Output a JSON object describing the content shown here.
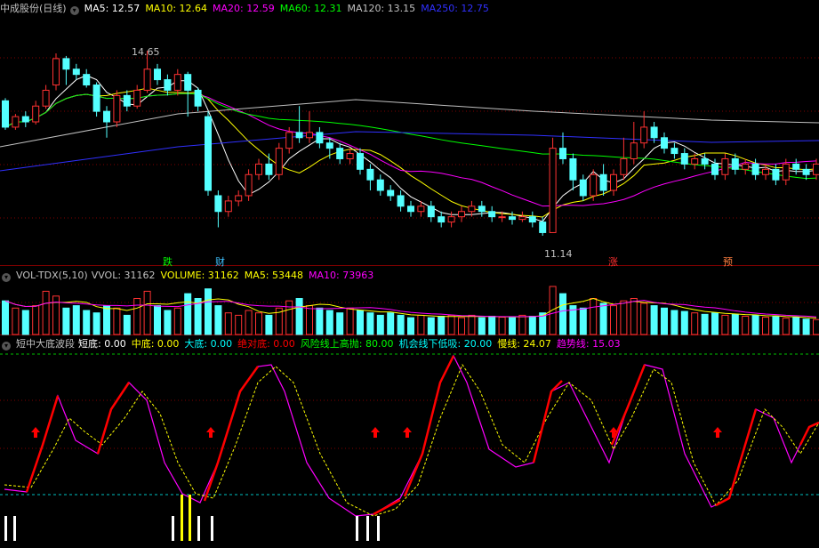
{
  "colors": {
    "up": "#ff3232",
    "down": "#54ffff",
    "ma5": "#ffffff",
    "ma10": "#ffff00",
    "ma20": "#ff00ff",
    "ma60": "#00ff00",
    "ma120": "#c0c0c0",
    "ma250": "#3030ff",
    "grid": "#800000",
    "text": "#c0c0c0"
  },
  "price_panel": {
    "header": {
      "title": "中成股份(日线)",
      "ma5": "MA5: 12.57",
      "ma10": "MA10: 12.64",
      "ma20": "MA20: 12.59",
      "ma60": "MA60: 12.31",
      "ma120": "MA120: 13.15",
      "ma250": "MA250: 12.75"
    },
    "high_label": "14.65",
    "low_label": "11.14",
    "markers": [
      {
        "text": "跌",
        "color": "#00ff00"
      },
      {
        "text": "财",
        "color": "#3ec1ff"
      },
      {
        "text": "涨",
        "color": "#ff3030"
      },
      {
        "text": "预",
        "color": "#ff8040"
      }
    ]
  },
  "volume_panel": {
    "header": {
      "title": "VOL-TDX(5,10)",
      "vvol": "VVOL: 31162",
      "volume": "VOLUME: 31162",
      "ma5": "MA5: 53448",
      "ma10": "MA10: 73963"
    }
  },
  "indicator_panel": {
    "header": {
      "title": "短中大底波段",
      "short": "短底: 0.00",
      "mid": "中底: 0.00",
      "big": "大底: 0.00",
      "abs": "绝对底: 0.00",
      "risk": "风险线上高抛: 80.00",
      "chance": "机会线下低吸: 20.00",
      "slow": "慢线: 24.07",
      "trend": "趋势线: 15.03"
    }
  },
  "chart_data": {
    "type": "candlestick",
    "candles": [
      [
        13.7,
        13.2,
        13.75,
        13.15
      ],
      [
        13.2,
        13.4,
        13.45,
        13.15
      ],
      [
        13.4,
        13.3,
        13.5,
        13.2
      ],
      [
        13.3,
        13.6,
        13.7,
        13.25
      ],
      [
        13.6,
        13.9,
        14.0,
        13.55
      ],
      [
        14.0,
        14.5,
        14.6,
        13.9
      ],
      [
        14.5,
        14.3,
        14.55,
        14.0
      ],
      [
        14.3,
        14.2,
        14.4,
        14.1
      ],
      [
        14.2,
        14.0,
        14.3,
        13.95
      ],
      [
        14.0,
        13.5,
        14.05,
        13.4
      ],
      [
        13.5,
        13.3,
        13.6,
        13.0
      ],
      [
        13.3,
        13.8,
        13.9,
        13.2
      ],
      [
        13.8,
        13.6,
        13.9,
        13.5
      ],
      [
        13.6,
        13.9,
        14.0,
        13.55
      ],
      [
        13.9,
        14.3,
        14.65,
        13.85
      ],
      [
        14.3,
        14.1,
        14.4,
        14.0
      ],
      [
        14.1,
        13.9,
        14.2,
        13.8
      ],
      [
        13.9,
        14.2,
        14.3,
        13.8
      ],
      [
        14.2,
        13.9,
        14.25,
        13.4
      ],
      [
        13.9,
        13.6,
        13.95,
        13.5
      ],
      [
        13.4,
        12.0,
        13.5,
        11.9
      ],
      [
        11.9,
        11.6,
        12.0,
        11.3
      ],
      [
        11.6,
        11.8,
        11.9,
        11.5
      ],
      [
        11.8,
        11.9,
        12.0,
        11.7
      ],
      [
        11.9,
        12.3,
        12.4,
        11.8
      ],
      [
        12.3,
        12.5,
        12.6,
        12.2
      ],
      [
        12.5,
        12.3,
        12.7,
        12.2
      ],
      [
        12.3,
        12.8,
        12.9,
        12.2
      ],
      [
        12.8,
        13.1,
        13.2,
        12.7
      ],
      [
        13.1,
        13.0,
        13.6,
        12.9
      ],
      [
        13.0,
        13.1,
        13.5,
        12.9
      ],
      [
        13.1,
        12.9,
        13.2,
        12.8
      ],
      [
        12.9,
        12.8,
        13.0,
        12.6
      ],
      [
        12.8,
        12.6,
        12.9,
        12.5
      ],
      [
        12.6,
        12.7,
        12.8,
        12.5
      ],
      [
        12.7,
        12.4,
        12.8,
        12.3
      ],
      [
        12.4,
        12.2,
        12.5,
        12.0
      ],
      [
        12.2,
        12.0,
        12.3,
        11.9
      ],
      [
        12.0,
        11.9,
        12.1,
        11.8
      ],
      [
        11.9,
        11.7,
        12.0,
        11.6
      ],
      [
        11.7,
        11.6,
        11.8,
        11.5
      ],
      [
        11.6,
        11.7,
        11.8,
        11.5
      ],
      [
        11.7,
        11.5,
        11.8,
        11.4
      ],
      [
        11.5,
        11.4,
        11.6,
        11.3
      ],
      [
        11.4,
        11.5,
        11.6,
        11.3
      ],
      [
        11.5,
        11.6,
        11.7,
        11.4
      ],
      [
        11.6,
        11.7,
        11.8,
        11.5
      ],
      [
        11.7,
        11.6,
        11.8,
        11.5
      ],
      [
        11.6,
        11.5,
        11.7,
        11.4
      ],
      [
        11.5,
        11.5,
        11.6,
        11.4
      ],
      [
        11.5,
        11.45,
        11.6,
        11.35
      ],
      [
        11.45,
        11.5,
        11.6,
        11.4
      ],
      [
        11.5,
        11.4,
        11.6,
        11.3
      ],
      [
        11.4,
        11.2,
        11.5,
        11.14
      ],
      [
        11.2,
        12.8,
        13.0,
        11.2
      ],
      [
        12.8,
        12.6,
        13.1,
        12.5
      ],
      [
        12.6,
        12.2,
        12.7,
        12.0
      ],
      [
        12.2,
        11.9,
        12.3,
        11.8
      ],
      [
        11.9,
        12.3,
        12.4,
        11.8
      ],
      [
        12.3,
        12.0,
        12.5,
        11.9
      ],
      [
        12.0,
        12.3,
        12.4,
        11.9
      ],
      [
        12.3,
        12.6,
        13.0,
        12.2
      ],
      [
        12.6,
        12.9,
        13.3,
        12.5
      ],
      [
        12.9,
        13.2,
        13.5,
        12.8
      ],
      [
        13.2,
        13.0,
        13.3,
        12.9
      ],
      [
        13.0,
        12.8,
        13.1,
        12.7
      ],
      [
        12.8,
        12.7,
        12.9,
        12.6
      ],
      [
        12.7,
        12.5,
        12.8,
        12.4
      ],
      [
        12.5,
        12.6,
        12.7,
        12.4
      ],
      [
        12.6,
        12.5,
        12.7,
        12.4
      ],
      [
        12.5,
        12.3,
        12.6,
        12.2
      ],
      [
        12.3,
        12.6,
        12.7,
        12.2
      ],
      [
        12.6,
        12.4,
        12.7,
        12.3
      ],
      [
        12.4,
        12.5,
        12.6,
        12.3
      ],
      [
        12.5,
        12.3,
        12.6,
        12.2
      ],
      [
        12.3,
        12.4,
        12.5,
        12.2
      ],
      [
        12.4,
        12.2,
        12.5,
        12.1
      ],
      [
        12.2,
        12.5,
        12.6,
        12.1
      ],
      [
        12.5,
        12.4,
        12.6,
        12.3
      ],
      [
        12.4,
        12.3,
        12.5,
        12.2
      ],
      [
        12.3,
        12.5,
        12.6,
        12.2
      ]
    ],
    "volume": [
      70,
      55,
      50,
      60,
      90,
      80,
      55,
      60,
      50,
      45,
      60,
      55,
      40,
      75,
      90,
      60,
      50,
      55,
      85,
      75,
      95,
      60,
      45,
      40,
      50,
      45,
      40,
      55,
      70,
      75,
      60,
      55,
      50,
      45,
      55,
      50,
      45,
      40,
      45,
      40,
      35,
      40,
      35,
      38,
      40,
      35,
      40,
      35,
      38,
      36,
      35,
      40,
      38,
      45,
      100,
      85,
      60,
      55,
      75,
      65,
      60,
      70,
      75,
      65,
      60,
      55,
      50,
      48,
      45,
      42,
      45,
      40,
      42,
      38,
      40,
      36,
      38,
      34,
      36,
      32,
      31
    ]
  }
}
